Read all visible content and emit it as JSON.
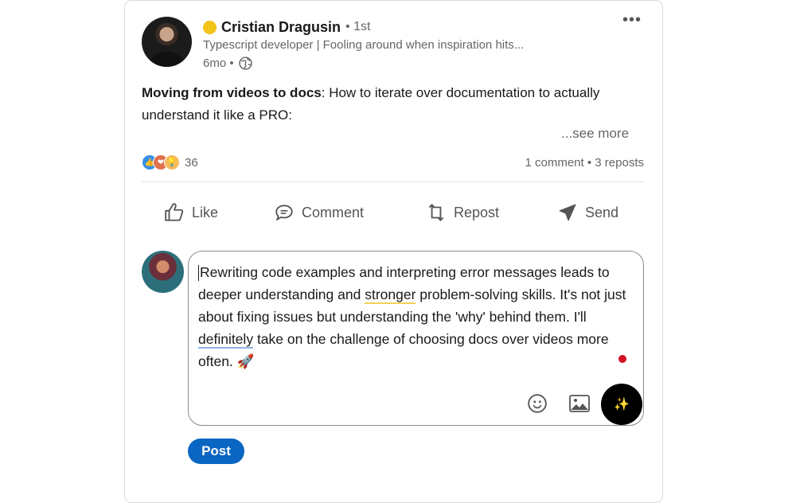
{
  "author": {
    "name": "Cristian Dragusin",
    "degree": "• 1st",
    "headline": "Typescript developer | Fooling around when inspiration hits...",
    "time": "6mo •",
    "status_color": "#f2c318"
  },
  "post": {
    "bold_lead": "Moving from videos to docs",
    "text": ": How to iterate over documentation to actually understand it like a PRO:",
    "see_more": "...see more"
  },
  "social": {
    "reaction_count": "36",
    "comments": "1 comment",
    "separator": "•",
    "reposts": "3 reposts",
    "reaction_icons": [
      "like-icon",
      "love-icon",
      "insightful-icon"
    ]
  },
  "actions": {
    "like": "Like",
    "comment": "Comment",
    "repost": "Repost",
    "send": "Send"
  },
  "comment": {
    "part1": "Rewriting code examples and interpreting error messages leads to deeper understanding and ",
    "underlined1": "stronger",
    "part2": " problem-solving skills. It's not just about fixing issues but understanding the 'why' behind them. I'll ",
    "underlined2": "definitely",
    "part3": " take on the challenge of choosing docs over videos more often. 🚀",
    "ai_icon": "sparkle-icon"
  },
  "post_button": "Post",
  "colors": {
    "accent": "#0a66c2",
    "text": "#191919",
    "muted": "#666666",
    "unread_dot": "#d11124"
  }
}
